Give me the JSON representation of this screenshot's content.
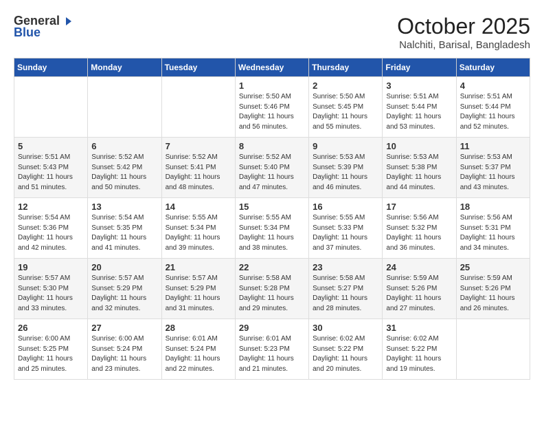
{
  "logo": {
    "general": "General",
    "blue": "Blue"
  },
  "header": {
    "month": "October 2025",
    "location": "Nalchiti, Barisal, Bangladesh"
  },
  "days_of_week": [
    "Sunday",
    "Monday",
    "Tuesday",
    "Wednesday",
    "Thursday",
    "Friday",
    "Saturday"
  ],
  "weeks": [
    [
      {
        "day": "",
        "content": ""
      },
      {
        "day": "",
        "content": ""
      },
      {
        "day": "",
        "content": ""
      },
      {
        "day": "1",
        "content": "Sunrise: 5:50 AM\nSunset: 5:46 PM\nDaylight: 11 hours\nand 56 minutes."
      },
      {
        "day": "2",
        "content": "Sunrise: 5:50 AM\nSunset: 5:45 PM\nDaylight: 11 hours\nand 55 minutes."
      },
      {
        "day": "3",
        "content": "Sunrise: 5:51 AM\nSunset: 5:44 PM\nDaylight: 11 hours\nand 53 minutes."
      },
      {
        "day": "4",
        "content": "Sunrise: 5:51 AM\nSunset: 5:44 PM\nDaylight: 11 hours\nand 52 minutes."
      }
    ],
    [
      {
        "day": "5",
        "content": "Sunrise: 5:51 AM\nSunset: 5:43 PM\nDaylight: 11 hours\nand 51 minutes."
      },
      {
        "day": "6",
        "content": "Sunrise: 5:52 AM\nSunset: 5:42 PM\nDaylight: 11 hours\nand 50 minutes."
      },
      {
        "day": "7",
        "content": "Sunrise: 5:52 AM\nSunset: 5:41 PM\nDaylight: 11 hours\nand 48 minutes."
      },
      {
        "day": "8",
        "content": "Sunrise: 5:52 AM\nSunset: 5:40 PM\nDaylight: 11 hours\nand 47 minutes."
      },
      {
        "day": "9",
        "content": "Sunrise: 5:53 AM\nSunset: 5:39 PM\nDaylight: 11 hours\nand 46 minutes."
      },
      {
        "day": "10",
        "content": "Sunrise: 5:53 AM\nSunset: 5:38 PM\nDaylight: 11 hours\nand 44 minutes."
      },
      {
        "day": "11",
        "content": "Sunrise: 5:53 AM\nSunset: 5:37 PM\nDaylight: 11 hours\nand 43 minutes."
      }
    ],
    [
      {
        "day": "12",
        "content": "Sunrise: 5:54 AM\nSunset: 5:36 PM\nDaylight: 11 hours\nand 42 minutes."
      },
      {
        "day": "13",
        "content": "Sunrise: 5:54 AM\nSunset: 5:35 PM\nDaylight: 11 hours\nand 41 minutes."
      },
      {
        "day": "14",
        "content": "Sunrise: 5:55 AM\nSunset: 5:34 PM\nDaylight: 11 hours\nand 39 minutes."
      },
      {
        "day": "15",
        "content": "Sunrise: 5:55 AM\nSunset: 5:34 PM\nDaylight: 11 hours\nand 38 minutes."
      },
      {
        "day": "16",
        "content": "Sunrise: 5:55 AM\nSunset: 5:33 PM\nDaylight: 11 hours\nand 37 minutes."
      },
      {
        "day": "17",
        "content": "Sunrise: 5:56 AM\nSunset: 5:32 PM\nDaylight: 11 hours\nand 36 minutes."
      },
      {
        "day": "18",
        "content": "Sunrise: 5:56 AM\nSunset: 5:31 PM\nDaylight: 11 hours\nand 34 minutes."
      }
    ],
    [
      {
        "day": "19",
        "content": "Sunrise: 5:57 AM\nSunset: 5:30 PM\nDaylight: 11 hours\nand 33 minutes."
      },
      {
        "day": "20",
        "content": "Sunrise: 5:57 AM\nSunset: 5:29 PM\nDaylight: 11 hours\nand 32 minutes."
      },
      {
        "day": "21",
        "content": "Sunrise: 5:57 AM\nSunset: 5:29 PM\nDaylight: 11 hours\nand 31 minutes."
      },
      {
        "day": "22",
        "content": "Sunrise: 5:58 AM\nSunset: 5:28 PM\nDaylight: 11 hours\nand 29 minutes."
      },
      {
        "day": "23",
        "content": "Sunrise: 5:58 AM\nSunset: 5:27 PM\nDaylight: 11 hours\nand 28 minutes."
      },
      {
        "day": "24",
        "content": "Sunrise: 5:59 AM\nSunset: 5:26 PM\nDaylight: 11 hours\nand 27 minutes."
      },
      {
        "day": "25",
        "content": "Sunrise: 5:59 AM\nSunset: 5:26 PM\nDaylight: 11 hours\nand 26 minutes."
      }
    ],
    [
      {
        "day": "26",
        "content": "Sunrise: 6:00 AM\nSunset: 5:25 PM\nDaylight: 11 hours\nand 25 minutes."
      },
      {
        "day": "27",
        "content": "Sunrise: 6:00 AM\nSunset: 5:24 PM\nDaylight: 11 hours\nand 23 minutes."
      },
      {
        "day": "28",
        "content": "Sunrise: 6:01 AM\nSunset: 5:24 PM\nDaylight: 11 hours\nand 22 minutes."
      },
      {
        "day": "29",
        "content": "Sunrise: 6:01 AM\nSunset: 5:23 PM\nDaylight: 11 hours\nand 21 minutes."
      },
      {
        "day": "30",
        "content": "Sunrise: 6:02 AM\nSunset: 5:22 PM\nDaylight: 11 hours\nand 20 minutes."
      },
      {
        "day": "31",
        "content": "Sunrise: 6:02 AM\nSunset: 5:22 PM\nDaylight: 11 hours\nand 19 minutes."
      },
      {
        "day": "",
        "content": ""
      }
    ]
  ]
}
